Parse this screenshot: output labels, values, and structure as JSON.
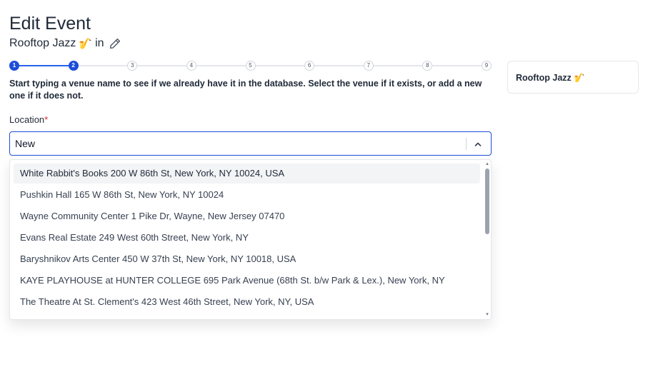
{
  "page": {
    "title": "Edit Event",
    "event_name": "Rooftop Jazz",
    "event_emoji": "🎷",
    "in_text": "in",
    "edit_icon": "pencil-icon"
  },
  "stepper": {
    "steps": [
      "1",
      "2",
      "3",
      "4",
      "5",
      "6",
      "7",
      "8",
      "9"
    ],
    "current": 2
  },
  "instructions": "Start typing a venue name to see if we already have it in the database. Select the venue if it exists, or add a new one if it does not.",
  "location": {
    "label": "Location",
    "required_mark": "*",
    "value": "New",
    "chevron_icon": "chevron-up-icon"
  },
  "dropdown": {
    "options": [
      "White Rabbit's Books 200 W 86th St, New York, NY 10024, USA",
      "Pushkin Hall 165 W 86th St, New York, NY 10024",
      "Wayne Community Center 1 Pike Dr, Wayne, New Jersey 07470",
      "Evans Real Estate 249 West 60th Street, New York, NY",
      "Baryshnikov Arts Center 450 W 37th St, New York, NY 10018, USA",
      "KAYE PLAYHOUSE at HUNTER COLLEGE 695 Park Avenue (68th St. b/w Park & Lex.), New York, NY",
      "The Theatre At St. Clement's 423 West 46th Street, New York, NY, USA"
    ],
    "highlighted_index": 0
  },
  "summary_card": {
    "name": "Rooftop Jazz",
    "emoji": "🎷"
  },
  "colors": {
    "accent": "#1d4ed8",
    "required": "#dc2626",
    "highlight": "#f3f4f6"
  }
}
